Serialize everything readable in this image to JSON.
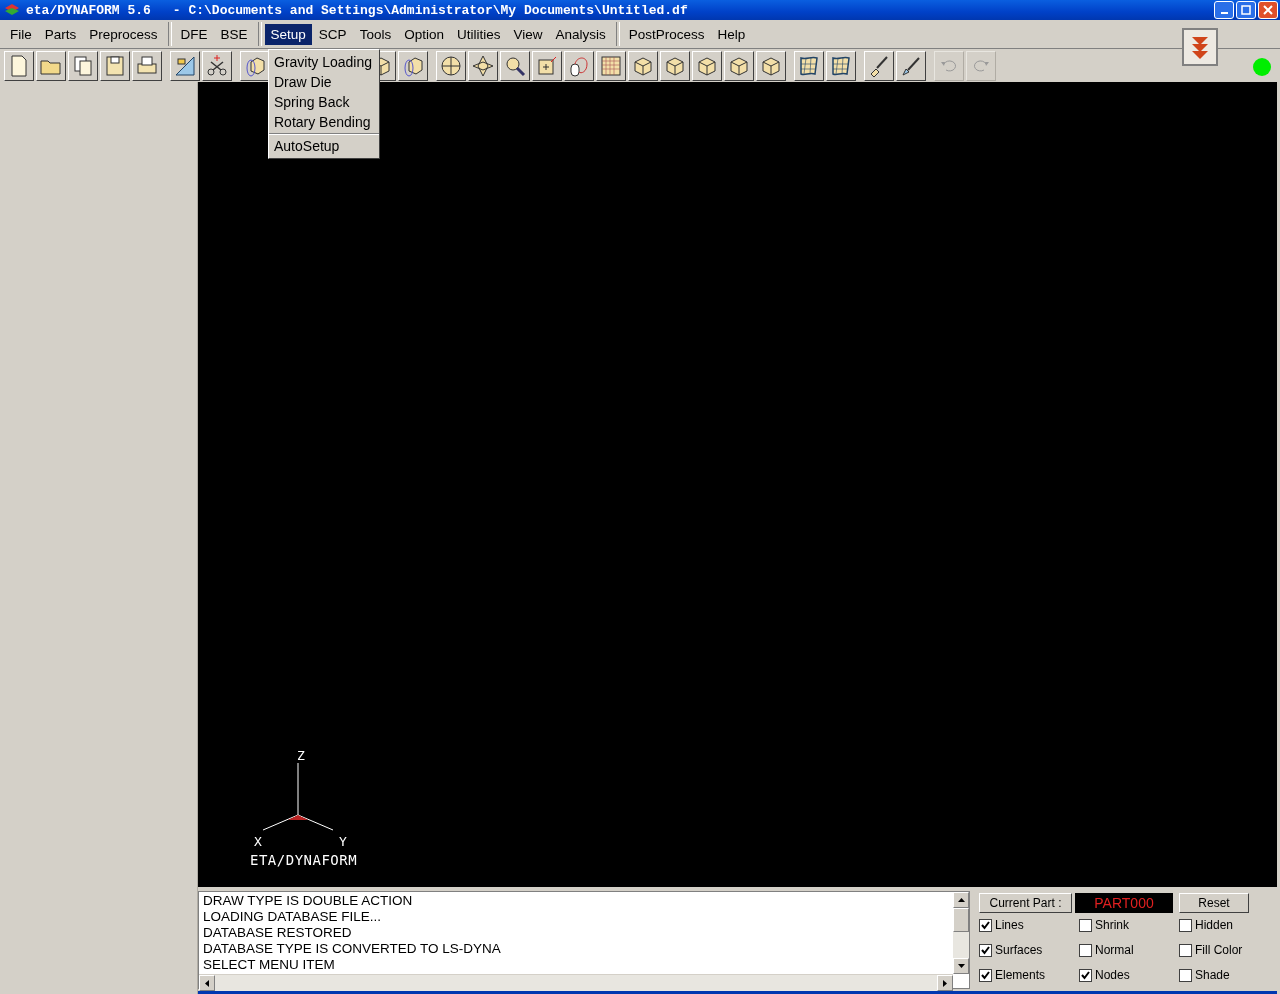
{
  "window": {
    "app": "eta/DYNAFORM 5.6",
    "path": "- C:\\Documents and Settings\\Administrator\\My Documents\\Untitled.df"
  },
  "menu_groups": [
    [
      {
        "label": "File",
        "selected": false
      },
      {
        "label": "Parts",
        "selected": false
      },
      {
        "label": "Preprocess",
        "selected": false
      }
    ],
    [
      {
        "label": "DFE",
        "selected": false
      },
      {
        "label": "BSE",
        "selected": false
      }
    ],
    [
      {
        "label": "Setup",
        "selected": true
      },
      {
        "label": "SCP",
        "selected": false
      },
      {
        "label": "Tools",
        "selected": false
      },
      {
        "label": "Option",
        "selected": false
      },
      {
        "label": "Utilities",
        "selected": false
      },
      {
        "label": "View",
        "selected": false
      },
      {
        "label": "Analysis",
        "selected": false
      }
    ],
    [
      {
        "label": "PostProcess",
        "selected": false
      },
      {
        "label": "Help",
        "selected": false
      }
    ]
  ],
  "dropdown_groups": [
    [
      "Gravity Loading",
      "Draw Die",
      "Spring Back",
      "Rotary Bending"
    ],
    [
      "AutoSetup"
    ]
  ],
  "viewport": {
    "axis_z": "Z",
    "axis_x": "X",
    "axis_y": "Y",
    "logo": "ETA/DYNAFORM"
  },
  "messages": [
    "DRAW TYPE IS DOUBLE ACTION",
    "LOADING DATABASE FILE...",
    "DATABASE RESTORED",
    "DATABASE TYPE IS CONVERTED TO LS-DYNA",
    "SELECT MENU ITEM"
  ],
  "display": {
    "current_part_label": "Current Part :",
    "current_part": "PART000",
    "reset": "Reset",
    "options": [
      {
        "label": "Lines",
        "checked": true
      },
      {
        "label": "Shrink",
        "checked": false
      },
      {
        "label": "Hidden",
        "checked": false
      },
      {
        "label": "Surfaces",
        "checked": true
      },
      {
        "label": "Normal",
        "checked": false
      },
      {
        "label": "Fill Color",
        "checked": false
      },
      {
        "label": "Elements",
        "checked": true
      },
      {
        "label": "Nodes",
        "checked": true
      },
      {
        "label": "Shade",
        "checked": false
      }
    ]
  }
}
